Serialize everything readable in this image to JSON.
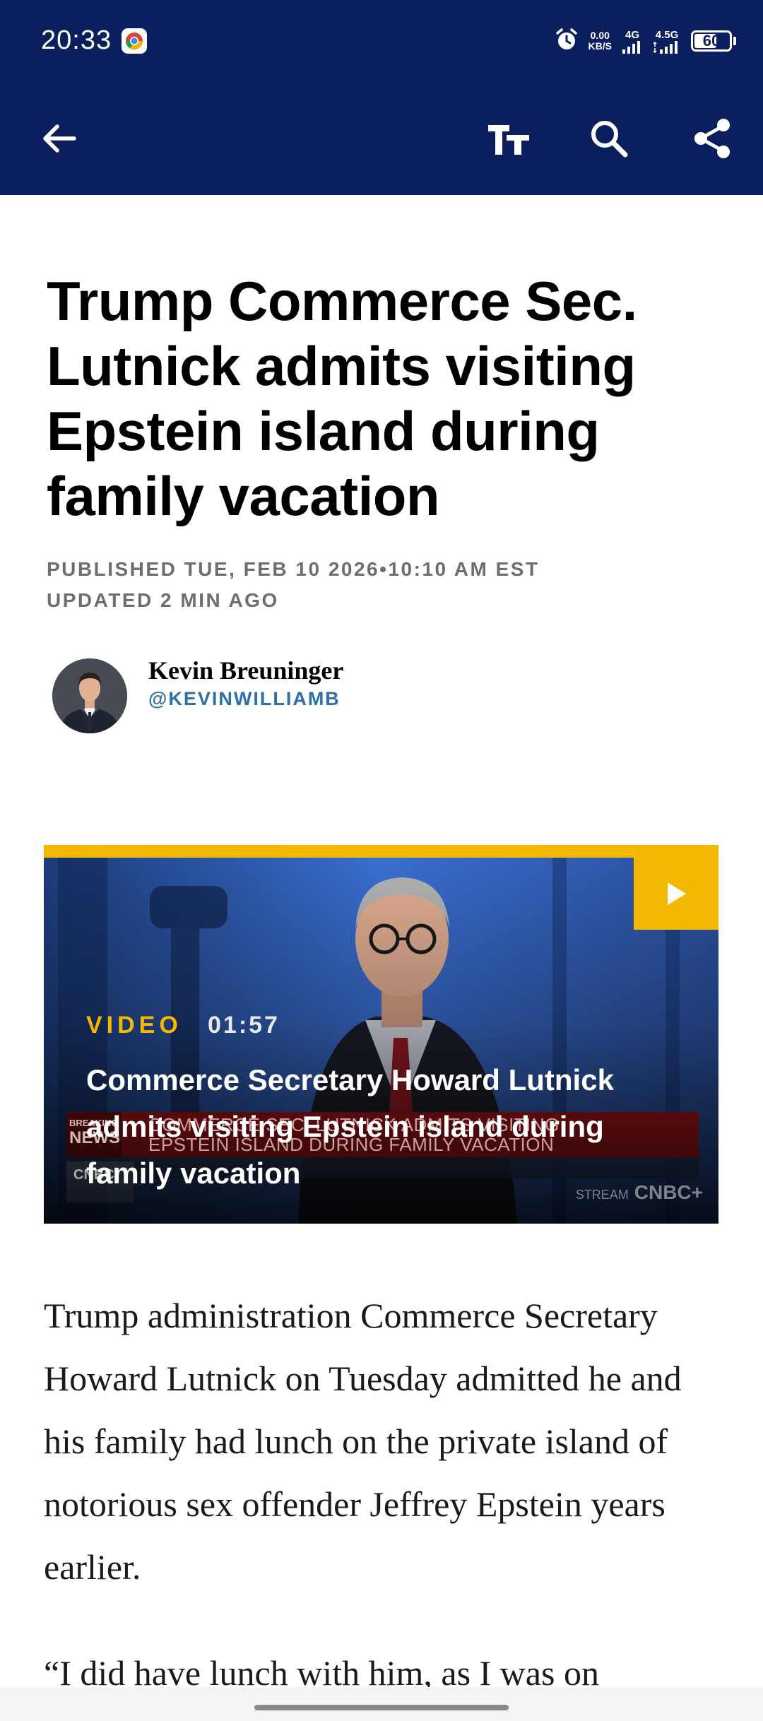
{
  "status_bar": {
    "time": "20:33",
    "net_speed_value": "0.00",
    "net_speed_unit": "KB/S",
    "signal_1_label": "4G",
    "signal_2_label": "4.5G",
    "battery_level": "60"
  },
  "toolbar": {
    "back_icon": "arrow-left-icon",
    "text_size_icon": "text-size-icon",
    "search_icon": "search-icon",
    "share_icon": "share-icon"
  },
  "article": {
    "headline": "Trump Commerce Sec. Lutnick admits visiting Epstein island during family vacation",
    "published": "PUBLISHED TUE, FEB 10 2026•10:10 AM EST",
    "updated": "UPDATED 2 MIN AGO",
    "author": {
      "name": "Kevin Breuninger",
      "handle": "@KEVINWILLIAMB"
    },
    "video": {
      "tag": "VIDEO",
      "duration": "01:57",
      "title": "Commerce Secretary Howard Lutnick admits visiting Epstein island during family vacation",
      "ticker_label_top": "BREAKING",
      "ticker_label_bottom": "NEWS",
      "ticker_line_1": "COMMERCE SEC. LUTNICK ADMITS VISITING",
      "ticker_line_2": "EPSTEIN ISLAND DURING FAMILY VACATION",
      "network_logo": "CNBC",
      "stream_label": "STREAM",
      "stream_logo": "CNBC+"
    },
    "paragraphs": [
      "Trump administration Commerce Secretary Howard Lutnick on Tuesday admitted he and his family had lunch on the private island of notorious sex offender Jeffrey Epstein years earlier.",
      "“I did have lunch with him, as I was on"
    ]
  },
  "colors": {
    "header_bg": "#0b1f5e",
    "accent_yellow": "#f5b800",
    "handle_blue": "#2d6fa8",
    "meta_gray": "#6e6e6e"
  }
}
